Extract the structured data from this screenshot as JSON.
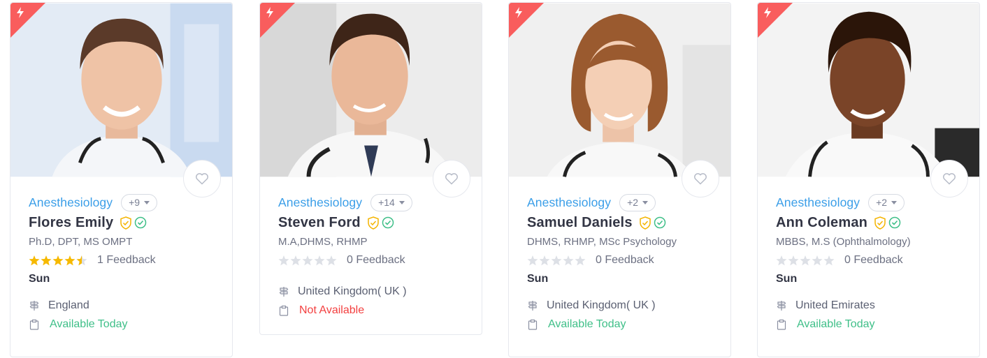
{
  "colors": {
    "accent_blue": "#3a9ee8",
    "ribbon_red": "#f95d5d",
    "available_green": "#3fbf88",
    "unavailable_red": "#f33f3f",
    "star_gold": "#f6b900",
    "star_empty": "#dde0e6"
  },
  "cards": [
    {
      "specialty": "Anesthesiology",
      "more": "+9",
      "name": "Flores Emily",
      "degree": "Ph.D, DPT, MS OMPT",
      "rating": 4.5,
      "feedback": "1 Feedback",
      "day": "Sun",
      "location": "England",
      "availability": "Available Today",
      "available": true
    },
    {
      "specialty": "Anesthesiology",
      "more": "+14",
      "name": "Steven Ford",
      "degree": "M.A,DHMS, RHMP",
      "rating": 0,
      "feedback": "0 Feedback",
      "day": "",
      "location": "United Kingdom( UK )",
      "availability": "Not Available",
      "available": false
    },
    {
      "specialty": "Anesthesiology",
      "more": "+2",
      "name": "Samuel Daniels",
      "degree": "DHMS, RHMP, MSc Psychology",
      "rating": 0,
      "feedback": "0 Feedback",
      "day": "Sun",
      "location": "United Kingdom( UK )",
      "availability": "Available Today",
      "available": true
    },
    {
      "specialty": "Anesthesiology",
      "more": "+2",
      "name": "Ann Coleman",
      "degree": "MBBS, M.S (Ophthalmology)",
      "rating": 0,
      "feedback": "0 Feedback",
      "day": "Sun",
      "location": "United Emirates",
      "availability": "Available Today",
      "available": true
    }
  ]
}
